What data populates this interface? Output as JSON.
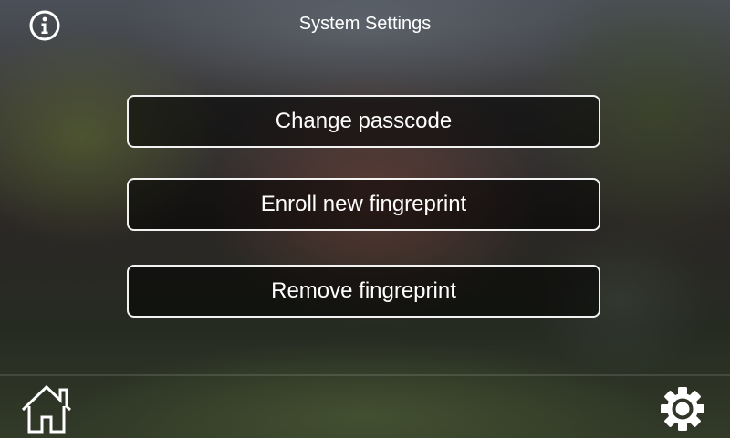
{
  "header": {
    "title": "System Settings",
    "info_icon": "info-circle-icon"
  },
  "menu": {
    "items": [
      {
        "label": "Change passcode"
      },
      {
        "label": "Enroll new fingreprint"
      },
      {
        "label": "Remove fingreprint"
      }
    ]
  },
  "footer": {
    "home_icon": "home-icon",
    "settings_icon": "gear-icon"
  },
  "colors": {
    "text": "#ffffff",
    "button_border": "#f2f2f2",
    "button_fill": "rgba(0,0,0,0.55)"
  }
}
